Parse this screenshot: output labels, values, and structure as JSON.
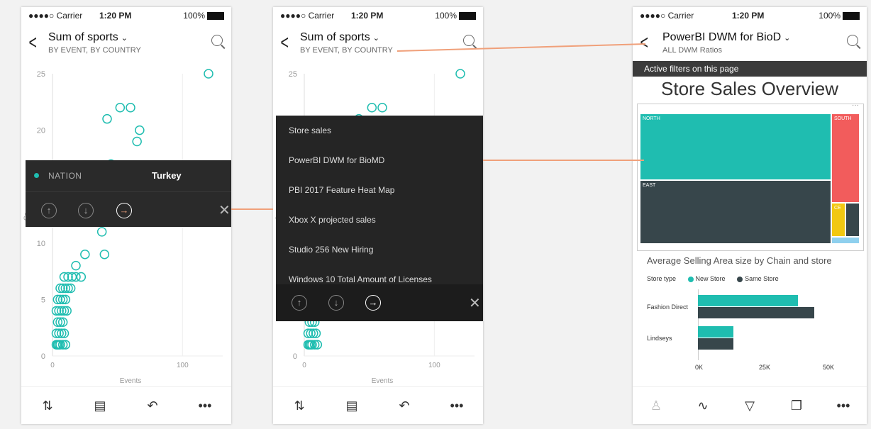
{
  "status": {
    "carrier": "●●●●○ Carrier",
    "wifi": "ᯤ",
    "time": "1:20 PM",
    "battery": "100%",
    "bt": "✱"
  },
  "report": {
    "title": "Sum of sports",
    "subtitle": "BY EVENT, BY COUNTRY",
    "y_ticks": [
      "25",
      "20",
      "10",
      "5",
      "0"
    ],
    "y_axis_label": "Co",
    "x_ticks": [
      "0",
      "100"
    ],
    "x_label": "Events"
  },
  "tooltip": {
    "field": "NATION",
    "value": "Turkey",
    "close": "✕"
  },
  "menu": {
    "items": [
      "Store sales",
      "PowerBI DWM for BioMD",
      "PBI 2017 Feature Heat Map",
      "Xbox X projected sales",
      "Studio 256 New Hiring",
      "Windows 10 Total Amount of Licenses"
    ],
    "close": "✕"
  },
  "dashboard": {
    "title": "PowerBI DWM for BioD",
    "subtitle": "ALL DWM Ratios",
    "filters": "Active filters on this page",
    "page_title": "Store Sales Overview",
    "treemap": {
      "north": "NORTH",
      "south": "SOUTH",
      "east": "EAST",
      "ce": "CE",
      "more": "···"
    },
    "chart_title": "Average Selling Area size by Chain and store",
    "legend_label": "Store type",
    "legend_new": "New Store",
    "legend_same": "Same Store",
    "rows": [
      "Fashion Direct",
      "Lindseys"
    ],
    "axis": [
      "0K",
      "25K",
      "50K"
    ]
  },
  "colors": {
    "teal": "#1fbdb0",
    "dark": "#37464b",
    "red": "#f25c5c",
    "yellow": "#f2c811",
    "orange": "#f0a07a"
  },
  "chart_data": {
    "type": "scatter",
    "title": "",
    "xlabel": "Events",
    "ylabel": "",
    "xlim": [
      0,
      120
    ],
    "ylim": [
      0,
      25
    ],
    "x": [
      3,
      4,
      5,
      6,
      8,
      10,
      3,
      5,
      7,
      9,
      4,
      6,
      8,
      3,
      5,
      7,
      9,
      11,
      4,
      6,
      8,
      10,
      6,
      8,
      10,
      12,
      14,
      9,
      12,
      15,
      18,
      22,
      18,
      25,
      40,
      38,
      50,
      42,
      45,
      65,
      67,
      52,
      42,
      60,
      120
    ],
    "y": [
      1,
      1,
      1,
      1,
      1,
      1,
      2,
      2,
      2,
      2,
      3,
      3,
      3,
      4,
      4,
      4,
      4,
      4,
      5,
      5,
      5,
      5,
      6,
      6,
      6,
      6,
      6,
      7,
      7,
      7,
      7,
      7,
      8,
      9,
      9,
      11,
      12,
      13,
      17,
      19,
      20,
      22,
      21,
      22,
      25
    ]
  }
}
